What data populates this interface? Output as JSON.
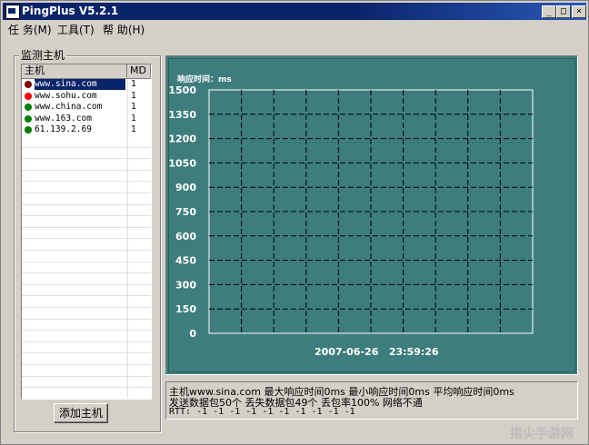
{
  "window": {
    "title": "PingPlus V5.2.1"
  },
  "titlebar_buttons": {
    "minimize": "_",
    "maximize": "□",
    "close": "×"
  },
  "menu": [
    {
      "label": "任 务(M)"
    },
    {
      "label": "工具(T)"
    },
    {
      "label": "帮 助(H)"
    }
  ],
  "sidebar": {
    "group_label": "监测主机",
    "columns": {
      "host": "主机",
      "md": "MD"
    },
    "hosts": [
      {
        "host": "www.sina.com",
        "md": "1",
        "status_color": "#800000",
        "selected": true
      },
      {
        "host": "www.sohu.com",
        "md": "1",
        "status_color": "#ff0000",
        "selected": false
      },
      {
        "host": "www.china.com",
        "md": "1",
        "status_color": "#008000",
        "selected": false
      },
      {
        "host": "www.163.com",
        "md": "1",
        "status_color": "#008000",
        "selected": false
      },
      {
        "host": "61.139.2.69",
        "md": "1",
        "status_color": "#008000",
        "selected": false
      }
    ],
    "add_button": "添加主机"
  },
  "chart_data": {
    "type": "line",
    "ylabel": "响应时间：ms",
    "yticks": [
      "1500",
      "1350",
      "1200",
      "1050",
      "900",
      "750",
      "600",
      "450",
      "300",
      "150",
      "0"
    ],
    "ylim": [
      0,
      1500
    ],
    "x_gridlines": 10,
    "timestamp": "2007-06-26   23:59:26",
    "series": [],
    "background": "#3e7d7d",
    "grid": true
  },
  "status": {
    "line1": "主机www.sina.com 最大响应时间0ms 最小响应时间0ms 平均响应时间0ms",
    "line2": " 发送数据包50个 丢失数据包49个 丢包率100% 网络不通",
    "line3": "RTT: -1 -1 -1 -1 -1 -1 -1 -1 -1 -1"
  },
  "watermark": "指尖手游网"
}
